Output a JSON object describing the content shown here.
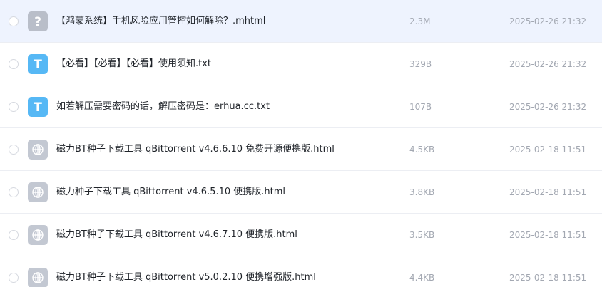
{
  "colors": {
    "selected_row_bg": "#eef3fe",
    "text_icon_blue": "#56b8f5",
    "unknown_icon_gray": "#b9bec9",
    "web_icon_gray": "#c3c8d2"
  },
  "files": [
    {
      "name": "【鸿蒙系统】手机风险应用管控如何解除？.mhtml",
      "size": "2.3M",
      "date": "2025-02-26 21:32",
      "icon": "unknown-file-icon",
      "icon_glyph": "?",
      "selected": true
    },
    {
      "name": "【必看】【必看】【必看】使用须知.txt",
      "size": "329B",
      "date": "2025-02-26 21:32",
      "icon": "text-file-icon",
      "icon_glyph": "T",
      "selected": false
    },
    {
      "name": "如若解压需要密码的话，解压密码是：erhua.cc.txt",
      "size": "107B",
      "date": "2025-02-26 21:32",
      "icon": "text-file-icon",
      "icon_glyph": "T",
      "selected": false
    },
    {
      "name": "磁力BT种子下载工具 qBittorrent v4.6.6.10 免费开源便携版.html",
      "size": "4.5KB",
      "date": "2025-02-18 11:51",
      "icon": "web-file-icon",
      "icon_glyph": "",
      "selected": false
    },
    {
      "name": "磁力种子下载工具 qBittorrent v4.6.5.10 便携版.html",
      "size": "3.8KB",
      "date": "2025-02-18 11:51",
      "icon": "web-file-icon",
      "icon_glyph": "",
      "selected": false
    },
    {
      "name": "磁力BT种子下载工具 qBittorrent v4.6.7.10 便携版.html",
      "size": "3.5KB",
      "date": "2025-02-18 11:51",
      "icon": "web-file-icon",
      "icon_glyph": "",
      "selected": false
    },
    {
      "name": "磁力BT种子下载工具 qBittorrent v5.0.2.10 便携增强版.html",
      "size": "4.4KB",
      "date": "2025-02-18 11:51",
      "icon": "web-file-icon",
      "icon_glyph": "",
      "selected": false
    }
  ]
}
